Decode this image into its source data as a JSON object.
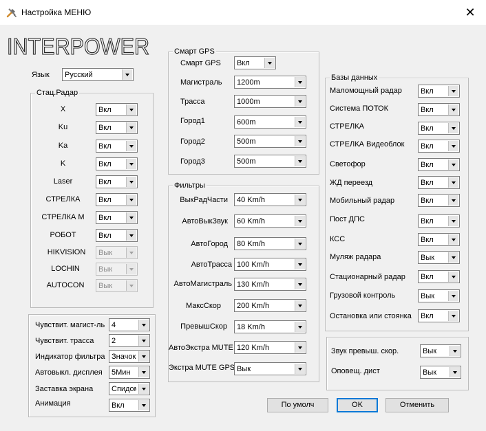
{
  "window": {
    "title": "Настройка МЕНЮ",
    "close_glyph": "✕"
  },
  "logo": {
    "text": "INTERPOWER"
  },
  "language": {
    "label": "Язык",
    "value": "Русский"
  },
  "stat_radar": {
    "title": "Стац.Радар",
    "rows": [
      {
        "label": "X",
        "value": "Вкл",
        "enabled": true
      },
      {
        "label": "Ku",
        "value": "Вкл",
        "enabled": true
      },
      {
        "label": "Ka",
        "value": "Вкл",
        "enabled": true
      },
      {
        "label": "K",
        "value": "Вкл",
        "enabled": true
      },
      {
        "label": "Laser",
        "value": "Вкл",
        "enabled": true
      },
      {
        "label": "СТРЕЛКА",
        "value": "Вкл",
        "enabled": true
      },
      {
        "label": "СТРЕЛКА М",
        "value": "Вкл",
        "enabled": true
      },
      {
        "label": "РОБОТ",
        "value": "Вкл",
        "enabled": true
      },
      {
        "label": "HIKVISION",
        "value": "Вык",
        "enabled": false
      },
      {
        "label": "LOCHIN",
        "value": "Вык",
        "enabled": false
      },
      {
        "label": "AUTOCON",
        "value": "Вык",
        "enabled": false
      }
    ]
  },
  "sensitivity": {
    "rows": [
      {
        "label": "Чувствит. магист-ль",
        "value": "4"
      },
      {
        "label": "Чувствит. трасса",
        "value": "2"
      },
      {
        "label": "Индикатор фильтра",
        "value": "Значок"
      },
      {
        "label": "Автовыкл. дисплея",
        "value": "5Мин"
      },
      {
        "label": "Заставка экрана",
        "value": "Спидометр"
      },
      {
        "label": "Анимация",
        "value": "Вкл"
      }
    ]
  },
  "smart_gps": {
    "title": "Смарт GPS",
    "rows": [
      {
        "label": "Смарт GPS",
        "value": "Вкл"
      },
      {
        "label": "Магистраль",
        "value": "1200m"
      },
      {
        "label": "Трасса",
        "value": "1000m"
      },
      {
        "label": "Город1",
        "value": "600m"
      },
      {
        "label": "Город2",
        "value": "500m"
      },
      {
        "label": "Город3",
        "value": "500m"
      }
    ]
  },
  "filters": {
    "title": "Фильтры",
    "rows": [
      {
        "label": "ВыкРадЧасти",
        "value": "40 Km/h"
      },
      {
        "label": "АвтоВыкЗвук",
        "value": "60 Km/h"
      },
      {
        "label": "АвтоГород",
        "value": "80 Km/h"
      },
      {
        "label": "АвтоТрасса",
        "value": "100 Km/h"
      },
      {
        "label": "АвтоМагистраль",
        "value": "130 Km/h"
      },
      {
        "label": "МаксСкор",
        "value": "200 Km/h"
      },
      {
        "label": "ПревышСкор",
        "value": "18 Km/h"
      },
      {
        "label": "АвтоЭкстра MUTE",
        "value": "120 Km/h"
      },
      {
        "label": "Экстра MUTE GPS",
        "value": "Вык"
      }
    ]
  },
  "databases": {
    "title": "Базы данных",
    "rows": [
      {
        "label": "Маломощный радар",
        "value": "Вкл"
      },
      {
        "label": "Система ПОТОК",
        "value": "Вкл"
      },
      {
        "label": "СТРЕЛКА",
        "value": "Вкл"
      },
      {
        "label": "СТРЕЛКА Видеоблок",
        "value": "Вкл"
      },
      {
        "label": "Светофор",
        "value": "Вкл"
      },
      {
        "label": "ЖД переезд",
        "value": "Вкл"
      },
      {
        "label": "Мобильный радар",
        "value": "Вкл"
      },
      {
        "label": "Пост ДПС",
        "value": "Вкл"
      },
      {
        "label": "КСС",
        "value": "Вкл"
      },
      {
        "label": "Муляж радара",
        "value": "Вык"
      },
      {
        "label": "Стационарный радар",
        "value": "Вкл"
      },
      {
        "label": "Грузовой контроль",
        "value": "Вык"
      },
      {
        "label": "Остановка или стоянка",
        "value": "Вкл"
      }
    ]
  },
  "sound": {
    "rows": [
      {
        "label": "Звук превыш. скор.",
        "value": "Вык"
      },
      {
        "label": "Оповещ. дист",
        "value": "Вык"
      }
    ]
  },
  "buttons": {
    "default": "По умолч",
    "ok": "OK",
    "cancel": "Отменить"
  }
}
